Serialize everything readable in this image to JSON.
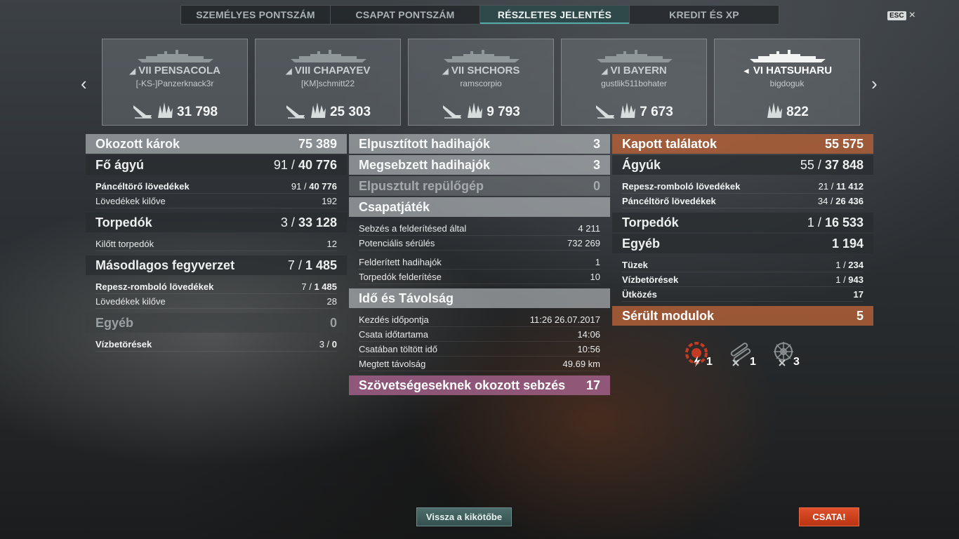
{
  "tabs": [
    {
      "label": "SZEMÉLYES PONTSZÁM"
    },
    {
      "label": "CSAPAT PONTSZÁM"
    },
    {
      "label": "RÉSZLETES JELENTÉS"
    },
    {
      "label": "KREDIT ÉS XP"
    }
  ],
  "esc": {
    "key": "ESC",
    "close": "×"
  },
  "nav": {
    "prev": "‹",
    "next": "›"
  },
  "ships": [
    {
      "tier_name": "VII PENSACOLA",
      "player": "[-KS-]Panzerknack3r",
      "damage": "31 798"
    },
    {
      "tier_name": "VIII CHAPAYEV",
      "player": "[KM]schmitt22",
      "damage": "25 303"
    },
    {
      "tier_name": "VII SHCHORS",
      "player": "ramscorpio",
      "damage": "9 793"
    },
    {
      "tier_name": "VI BAYERN",
      "player": "gustlik511bohater",
      "damage": "7 673"
    },
    {
      "tier_name": "VI HATSUHARU",
      "player": "bigdoguk",
      "damage": "822"
    }
  ],
  "left": {
    "total": {
      "label": "Okozott károk",
      "value": "75 389"
    },
    "main": {
      "label": "Fő ágyú",
      "hits": "91",
      "dmg": "40 776"
    },
    "main_rows": [
      {
        "label": "Páncéltörő lövedékek",
        "hits": "91",
        "dmg": "40 776"
      },
      {
        "label": "Lövedékek kilőve",
        "value": "192"
      }
    ],
    "torp": {
      "label": "Torpedók",
      "hits": "3",
      "dmg": "33 128"
    },
    "torp_rows": [
      {
        "label": "Kilőtt torpedók",
        "value": "12"
      }
    ],
    "sec": {
      "label": "Másodlagos fegyverzet",
      "hits": "7",
      "dmg": "1 485"
    },
    "sec_rows": [
      {
        "label": "Repesz-romboló lövedékek",
        "hits": "7",
        "dmg": "1 485"
      },
      {
        "label": "Lövedékek kilőve",
        "value": "28"
      }
    ],
    "other": {
      "label": "Egyéb",
      "value": "0"
    },
    "other_rows": [
      {
        "label": "Vízbetörések",
        "hits": "3",
        "dmg": "0"
      }
    ]
  },
  "middle": {
    "destroyed": {
      "label": "Elpusztított hadihajók",
      "value": "3"
    },
    "damaged": {
      "label": "Megsebzett hadihajók",
      "value": "3"
    },
    "planes": {
      "label": "Elpusztult repülőgép",
      "value": "0"
    },
    "team": {
      "label": "Csapatjáték"
    },
    "team_rows1": [
      {
        "label": "Sebzés a felderítésed által",
        "value": "4 211"
      },
      {
        "label": "Potenciális sérülés",
        "value": "732 269"
      }
    ],
    "team_rows2": [
      {
        "label": "Felderített hadihajók",
        "value": "1"
      },
      {
        "label": "Torpedók felderítése",
        "value": "10"
      }
    ],
    "time": {
      "label": "Idő és Távolság"
    },
    "time_rows": [
      {
        "label": "Kezdés időpontja",
        "value": "11:26  26.07.2017"
      },
      {
        "label": "Csata időtartama",
        "value": "14:06"
      },
      {
        "label": "Csatában töltött idő",
        "value": "10:56"
      },
      {
        "label": "Megtett távolság",
        "value": "49.69 km"
      }
    ],
    "ally": {
      "label": "Szövetségeseknek okozott sebzés",
      "value": "17"
    }
  },
  "right": {
    "received": {
      "label": "Kapott találatok",
      "value": "55 575"
    },
    "guns": {
      "label": "Ágyúk",
      "hits": "55",
      "dmg": "37 848"
    },
    "guns_rows": [
      {
        "label": "Repesz-romboló lövedékek",
        "hits": "21",
        "dmg": "11 412"
      },
      {
        "label": "Páncéltörő lövedékek",
        "hits": "34",
        "dmg": "26 436"
      }
    ],
    "torp": {
      "label": "Torpedók",
      "hits": "1",
      "dmg": "16 533"
    },
    "other": {
      "label": "Egyéb",
      "value": "1 194"
    },
    "other_rows": [
      {
        "label": "Tüzek",
        "hits": "1",
        "dmg": "234"
      },
      {
        "label": "Vízbetörések",
        "hits": "1",
        "dmg": "943"
      },
      {
        "label": "Ütközés",
        "value": "17"
      }
    ],
    "modules": {
      "label": "Sérült modulok",
      "value": "5"
    },
    "module_icons": [
      {
        "icon": "engine-damaged-icon",
        "count": "1",
        "color": "#c23b22"
      },
      {
        "icon": "torpedo-tube-icon",
        "count": "1",
        "color": "#9aa0a2"
      },
      {
        "icon": "steering-gear-icon",
        "count": "3",
        "color": "#9aa0a2"
      }
    ]
  },
  "buttons": {
    "port": "Vissza a kikötőbe",
    "battle": "CSATA!"
  }
}
